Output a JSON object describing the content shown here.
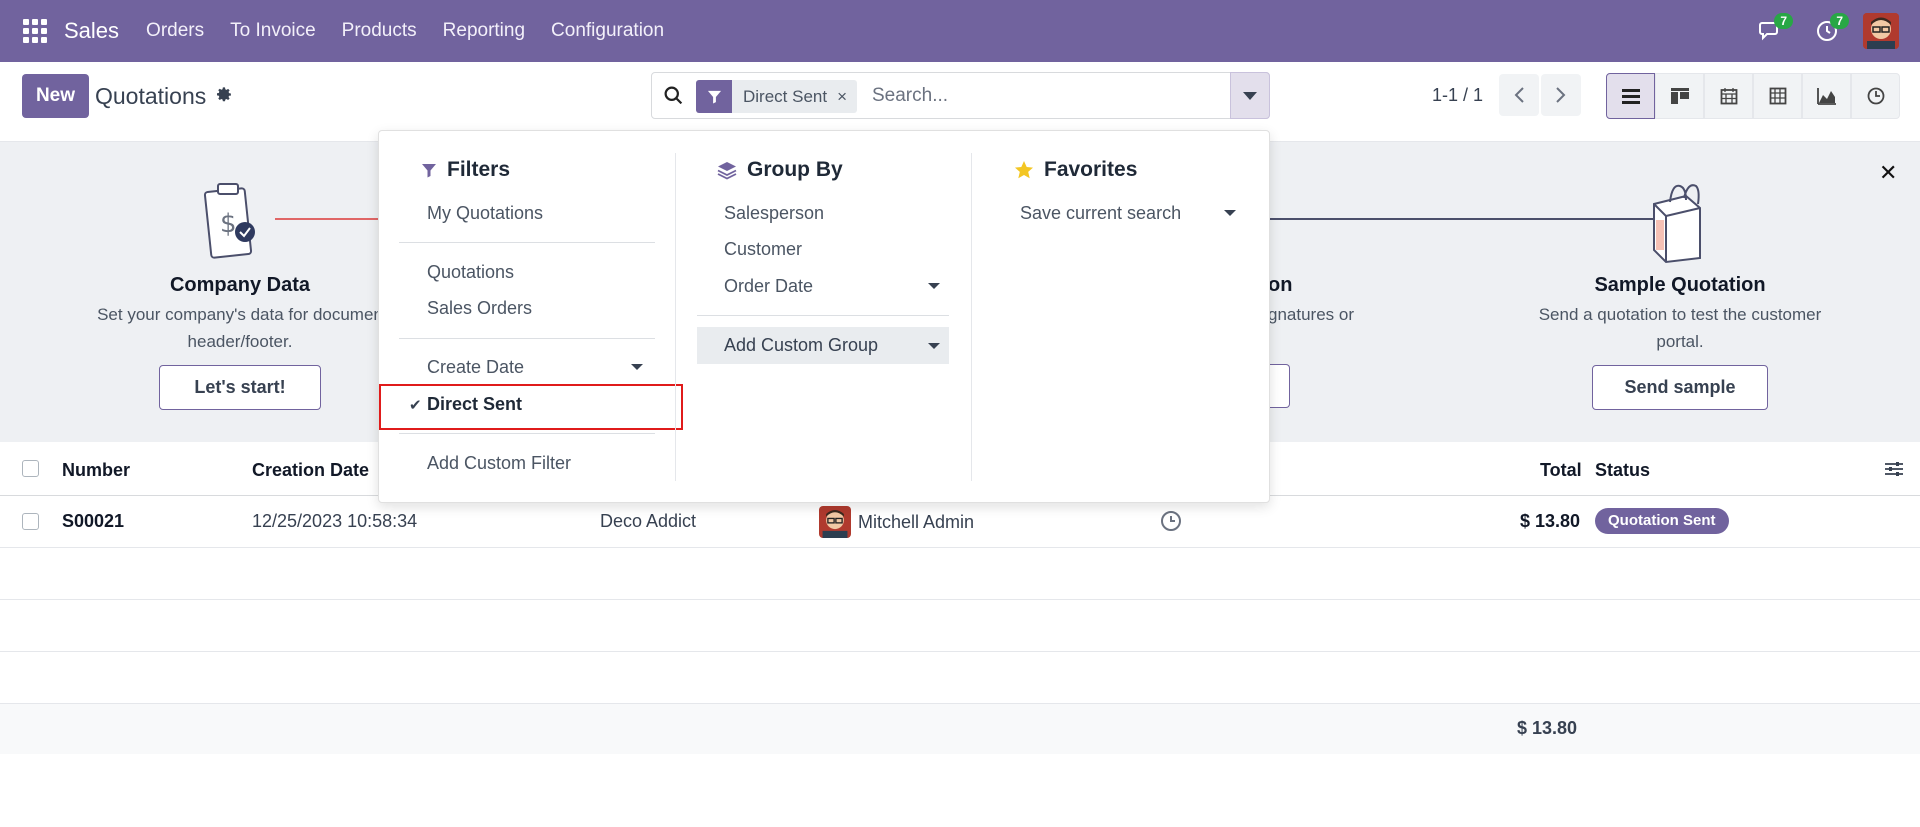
{
  "navbar": {
    "app_name": "Sales",
    "menu": [
      "Orders",
      "To Invoice",
      "Products",
      "Reporting",
      "Configuration"
    ],
    "messages_count": "7",
    "activities_count": "7",
    "bg_color": "#71639e"
  },
  "control_panel": {
    "new_button": "New",
    "title": "Quotations",
    "facet_label": "Direct Sent",
    "facet_remove": "×",
    "search_placeholder": "Search...",
    "pager": "1-1 / 1",
    "views": [
      "list-icon",
      "kanban-icon",
      "calendar-icon",
      "pivot-icon",
      "graph-icon",
      "activity-icon"
    ]
  },
  "banner": {
    "step1": {
      "title": "Company Data",
      "desc_line1": "Set your company's data for documen",
      "desc_line2": "header/footer.",
      "button": "Let's start!"
    },
    "step3_fragment": {
      "title": "on",
      "desc": "gnatures or"
    },
    "step4": {
      "title": "Sample Quotation",
      "desc_line1": "Send a quotation to test the customer",
      "desc_line2": "portal.",
      "button": "Send sample"
    }
  },
  "list": {
    "headers": {
      "number": "Number",
      "creation_date": "Creation Date",
      "total": "Total",
      "status": "Status"
    },
    "rows": [
      {
        "number": "S00021",
        "creation_date": "12/25/2023 10:58:34",
        "customer": "Deco Addict",
        "salesperson": "Mitchell Admin",
        "total": "$ 13.80",
        "status": "Quotation Sent"
      }
    ],
    "grand_total": "$ 13.80"
  },
  "dropdown": {
    "filters": {
      "title": "Filters",
      "items": [
        "My Quotations",
        "Quotations",
        "Sales Orders",
        "Create Date",
        "Direct Sent",
        "Add Custom Filter"
      ],
      "selected": "Direct Sent"
    },
    "group_by": {
      "title": "Group By",
      "items": [
        "Salesperson",
        "Customer",
        "Order Date"
      ],
      "custom": "Add Custom Group"
    },
    "favorites": {
      "title": "Favorites",
      "items": [
        "Save current search"
      ]
    }
  }
}
